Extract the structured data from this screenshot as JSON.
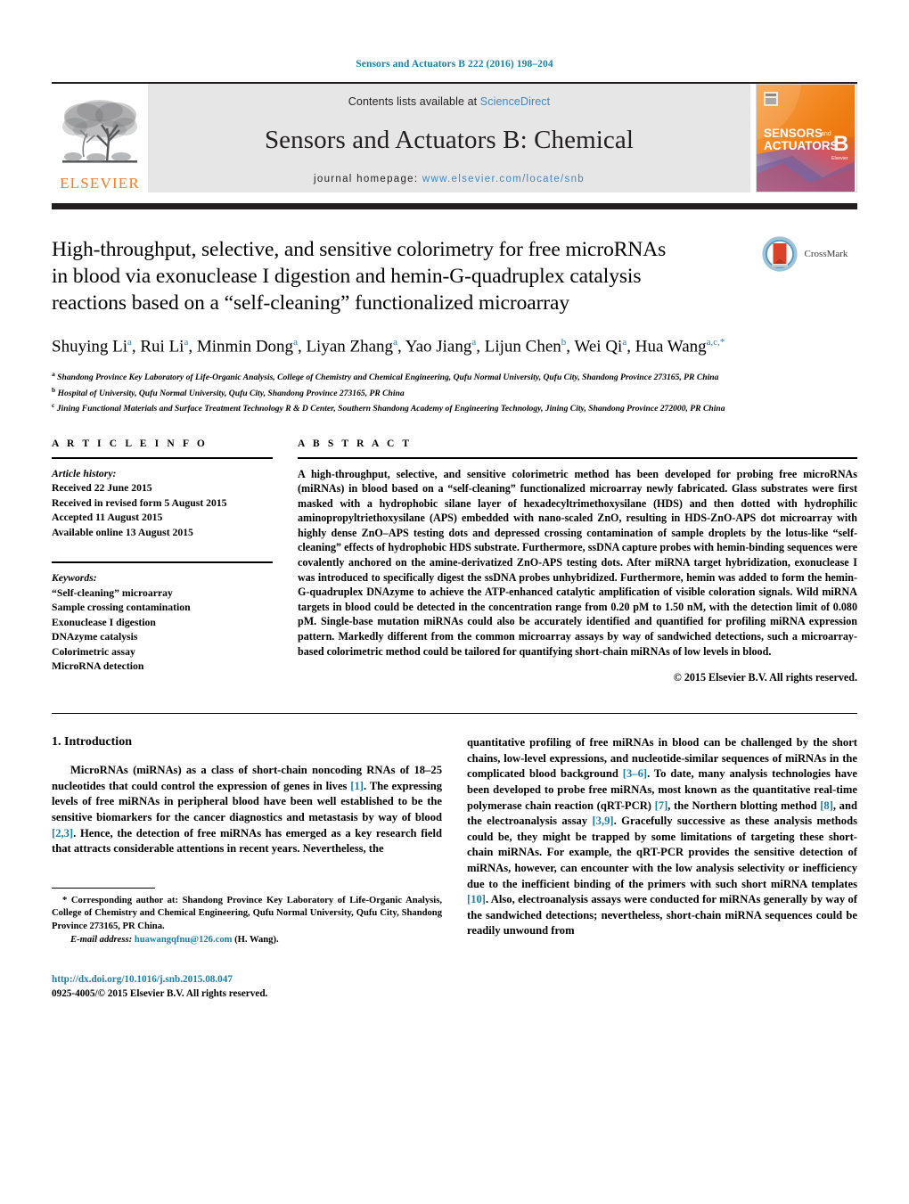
{
  "running_head": "Sensors and Actuators B 222 (2016) 198–204",
  "masthead": {
    "contents_prefix": "Contents lists available at ",
    "sciencedirect": "ScienceDirect",
    "journal_title": "Sensors and Actuators B: Chemical",
    "homepage_prefix": "journal homepage: ",
    "homepage_url": "www.elsevier.com/locate/snb",
    "publisher_wordmark": "ELSEVIER",
    "publisher_logo_name": "elsevier-tree-logo",
    "cover": {
      "line1": "SENSORS",
      "and": "and",
      "line2": "ACTUATORS",
      "letter": "B",
      "imprint": "Elsevier"
    }
  },
  "crossmark": {
    "label": "CrossMark",
    "icon": "crossmark-icon"
  },
  "title": "High-throughput, selective, and sensitive colorimetry for free microRNAs in blood via exonuclease I digestion and hemin-G-quadruplex catalysis reactions based on a “self-cleaning” functionalized microarray",
  "authors": [
    {
      "name": "Shuying Li",
      "sup": "a"
    },
    {
      "name": "Rui Li",
      "sup": "a"
    },
    {
      "name": "Minmin Dong",
      "sup": "a"
    },
    {
      "name": "Liyan Zhang",
      "sup": "a"
    },
    {
      "name": "Yao Jiang",
      "sup": "a"
    },
    {
      "name": "Lijun Chen",
      "sup": "b"
    },
    {
      "name": "Wei Qi",
      "sup": "a"
    },
    {
      "name": "Hua Wang",
      "sup": "a,c,*"
    }
  ],
  "affiliations": [
    {
      "marker": "a",
      "text": "Shandong Province Key Laboratory of Life-Organic Analysis, College of Chemistry and Chemical Engineering, Qufu Normal University, Qufu City, Shandong Province 273165, PR China"
    },
    {
      "marker": "b",
      "text": "Hospital of University, Qufu Normal University, Qufu City, Shandong Province 273165, PR China"
    },
    {
      "marker": "c",
      "text": "Jining Functional Materials and Surface Treatment Technology R & D Center, Southern Shandong Academy of Engineering Technology, Jining City, Shandong Province 272000, PR China"
    }
  ],
  "article_info": {
    "heading": "A R T I C L E   I N F O",
    "history_label": "Article history:",
    "history": [
      "Received 22 June 2015",
      "Received in revised form 5 August 2015",
      "Accepted 11 August 2015",
      "Available online 13 August 2015"
    ],
    "keywords_label": "Keywords:",
    "keywords": [
      "“Self-cleaning” microarray",
      "Sample crossing contamination",
      "Exonuclease I digestion",
      "DNAzyme catalysis",
      "Colorimetric assay",
      "MicroRNA detection"
    ]
  },
  "abstract": {
    "heading": "A B S T R A C T",
    "text": "A high-throughput, selective, and sensitive colorimetric method has been developed for probing free microRNAs (miRNAs) in blood based on a “self-cleaning” functionalized microarray newly fabricated. Glass substrates were first masked with a hydrophobic silane layer of hexadecyltrimethoxysilane (HDS) and then dotted with hydrophilic aminopropyltriethoxysilane (APS) embedded with nano-scaled ZnO, resulting in HDS-ZnO-APS dot microarray with highly dense ZnO–APS testing dots and depressed crossing contamination of sample droplets by the lotus-like “self-cleaning” effects of hydrophobic HDS substrate. Furthermore, ssDNA capture probes with hemin-binding sequences were covalently anchored on the amine-derivatized ZnO-APS testing dots. After miRNA target hybridization, exonuclease I was introduced to specifically digest the ssDNA probes unhybridized. Furthermore, hemin was added to form the hemin-G-quadruplex DNAzyme to achieve the ATP-enhanced catalytic amplification of visible coloration signals. Wild miRNA targets in blood could be detected in the concentration range from 0.20 pM to 1.50 nM, with the detection limit of 0.080 pM. Single-base mutation miRNAs could also be accurately identified and quantified for profiling miRNA expression pattern. Markedly different from the common microarray assays by way of sandwiched detections, such a microarray-based colorimetric method could be tailored for quantifying short-chain miRNAs of low levels in blood.",
    "copyright": "© 2015 Elsevier B.V. All rights reserved."
  },
  "body": {
    "section_number_title": "1.  Introduction",
    "left_paragraph_parts": [
      {
        "t": "MicroRNAs (miRNAs) as a class of short-chain noncoding RNAs of 18–25 nucleotides that could control the expression of genes in lives "
      },
      {
        "t": "[1]",
        "ref": true
      },
      {
        "t": ". The expressing levels of free miRNAs in peripheral blood have been well established to be the sensitive biomarkers for the cancer diagnostics and metastasis by way of blood "
      },
      {
        "t": "[2,3]",
        "ref": true
      },
      {
        "t": ". Hence, the detection of free miRNAs has emerged as a key research field that attracts considerable attentions in recent years. Nevertheless, the"
      }
    ],
    "right_paragraph_parts": [
      {
        "t": "quantitative profiling of free miRNAs in blood can be challenged by the short chains, low-level expressions, and nucleotide-similar sequences of miRNAs in the complicated blood background "
      },
      {
        "t": "[3–6]",
        "ref": true
      },
      {
        "t": ". To date, many analysis technologies have been developed to probe free miRNAs, most known as the quantitative real-time polymerase chain reaction (qRT-PCR) "
      },
      {
        "t": "[7]",
        "ref": true
      },
      {
        "t": ", the Northern blotting method "
      },
      {
        "t": "[8]",
        "ref": true
      },
      {
        "t": ", and the electroanalysis assay "
      },
      {
        "t": "[3,9]",
        "ref": true
      },
      {
        "t": ". Gracefully successive as these analysis methods could be, they might be trapped by some limitations of targeting these short-chain miRNAs. For example, the qRT-PCR provides the sensitive detection of miRNAs, however, can encounter with the low analysis selectivity or inefficiency due to the inefficient binding of the primers with such short miRNA templates "
      },
      {
        "t": "[10]",
        "ref": true
      },
      {
        "t": ". Also, electroanalysis assays were conducted for miRNAs generally by way of the sandwiched detections; nevertheless, short-chain miRNA sequences could be readily unwound from"
      }
    ]
  },
  "footnote": {
    "star": "*",
    "text": "  Corresponding author at: Shandong Province Key Laboratory of Life-Organic Analysis, College of Chemistry and Chemical Engineering, Qufu Normal University, Qufu City, Shandong Province 273165, PR China.",
    "email_label": "E-mail address:",
    "email": "huawangqfnu@126.com",
    "email_suffix": " (H. Wang)."
  },
  "footer": {
    "doi": "http://dx.doi.org/10.1016/j.snb.2015.08.047",
    "issn": "0925-4005/© 2015 Elsevier B.V. All rights reserved."
  },
  "colors": {
    "link": "#1a7fa8",
    "sciencedirect": "#3f87c4",
    "elsevier_orange": "#F47B20",
    "band_gray": "#e6e6e6",
    "rule_black": "#231f20"
  }
}
